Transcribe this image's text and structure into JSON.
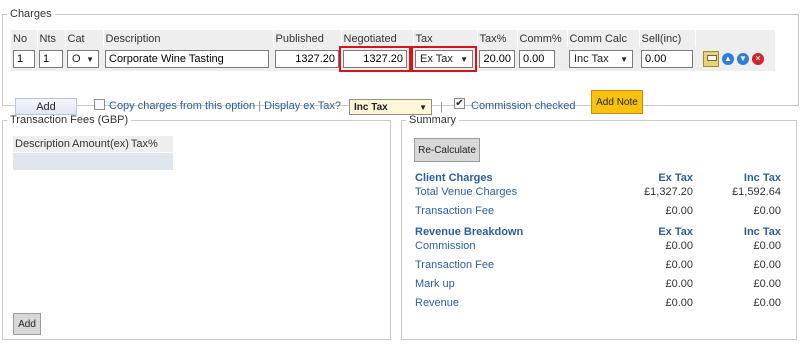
{
  "charges": {
    "legend": "Charges",
    "headers": [
      "No",
      "Nts",
      "Cat",
      "Description",
      "Published",
      "Negotiated",
      "Tax",
      "Tax%",
      "Comm%",
      "Comm Calc",
      "Sell(inc)"
    ],
    "row": {
      "no": "1",
      "nts": "1",
      "cat": "O",
      "description": "Corporate Wine Tasting",
      "published": "1327.20",
      "negotiated": "1327.20",
      "tax": "Ex Tax",
      "tax_pct": "20.00",
      "comm_pct": "0.00",
      "comm_calc": "Inc Tax",
      "sell_inc": "0.00"
    },
    "add_label": "Add",
    "copy_label": "Copy charges from this option",
    "display_ex_tax_label": "Display ex Tax?",
    "display_option": "Inc Tax",
    "commission_checked_label": "Commission checked",
    "add_note_label": "Add Note",
    "separator": "|",
    "dropdown_glyph": "▼"
  },
  "fees": {
    "legend": "Transaction Fees (GBP)",
    "headers": [
      "Description",
      "Amount(ex)",
      "Tax%"
    ],
    "add_label": "Add"
  },
  "summary": {
    "legend": "Summary",
    "recalc_label": "Re-Calculate",
    "client_charges": {
      "title": "Client Charges",
      "col_ex": "Ex Tax",
      "col_inc": "Inc Tax",
      "rows": [
        {
          "label": "Total Venue Charges",
          "ex": "£1,327.20",
          "inc": "£1,592.64"
        },
        {
          "label": "Transaction Fee",
          "ex": "£0.00",
          "inc": "£0.00"
        }
      ]
    },
    "revenue": {
      "title": "Revenue Breakdown",
      "col_ex": "Ex Tax",
      "col_inc": "Inc Tax",
      "rows": [
        {
          "label": "Commission",
          "ex": "£0.00",
          "inc": "£0.00"
        },
        {
          "label": "Transaction Fee",
          "ex": "£0.00",
          "inc": "£0.00"
        },
        {
          "label": "Mark up",
          "ex": "£0.00",
          "inc": "£0.00"
        },
        {
          "label": "Revenue",
          "ex": "£0.00",
          "inc": "£0.00"
        }
      ]
    }
  },
  "colors": {
    "highlight": "#d9151b",
    "link": "#2b5f9e",
    "add_note_bg": "#f9c30d"
  }
}
